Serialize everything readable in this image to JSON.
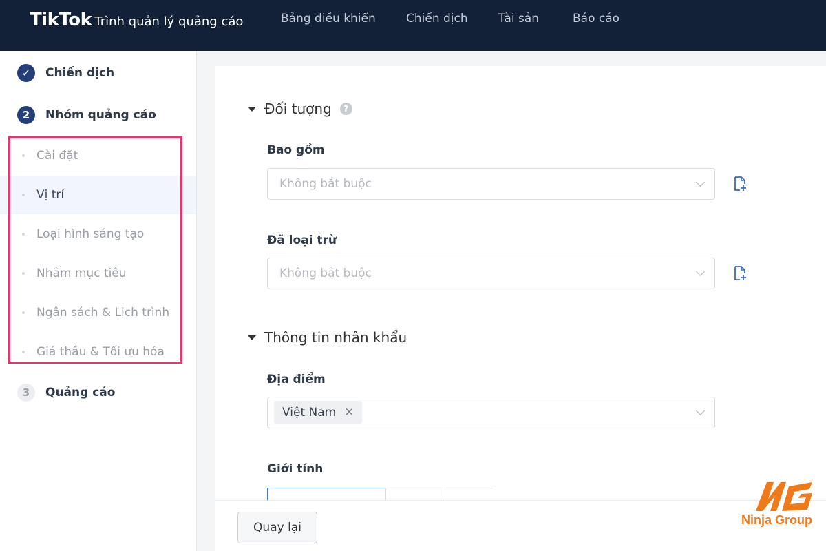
{
  "header": {
    "logo": "TikTok",
    "subtitle": "Trình quản lý quảng cáo",
    "nav": [
      "Bảng điều khiển",
      "Chiến dịch",
      "Tài sản",
      "Báo cáo"
    ]
  },
  "sidebar": {
    "steps": [
      {
        "badge": "✓",
        "label": "Chiến dịch",
        "state": "done"
      },
      {
        "badge": "2",
        "label": "Nhóm quảng cáo",
        "state": "active"
      },
      {
        "badge": "3",
        "label": "Quảng cáo",
        "state": "pending"
      }
    ],
    "substeps": [
      {
        "label": "Cài đặt",
        "selected": false
      },
      {
        "label": "Vị trí",
        "selected": true
      },
      {
        "label": "Loại hình sáng tạo",
        "selected": false
      },
      {
        "label": "Nhắm mục tiêu",
        "selected": false
      },
      {
        "label": "Ngân sách & Lịch trình",
        "selected": false
      },
      {
        "label": "Giá thầu & Tối ưu hóa",
        "selected": false
      }
    ]
  },
  "main": {
    "audience": {
      "title": "Đối tượng",
      "include_label": "Bao gồm",
      "include_placeholder": "Không bắt buộc",
      "exclude_label": "Đã loại trừ",
      "exclude_placeholder": "Không bắt buộc"
    },
    "demographics": {
      "title": "Thông tin nhân khẩu",
      "location_label": "Địa điểm",
      "location_tag": "Việt Nam",
      "gender_label": "Giới tính"
    }
  },
  "footer": {
    "back_label": "Quay lại"
  },
  "watermark": {
    "text": "Ninja Group"
  },
  "colors": {
    "topbar": "#122137",
    "step_badge": "#243f7a",
    "highlight": "#e8336b",
    "watermark": "#f07a1a"
  }
}
